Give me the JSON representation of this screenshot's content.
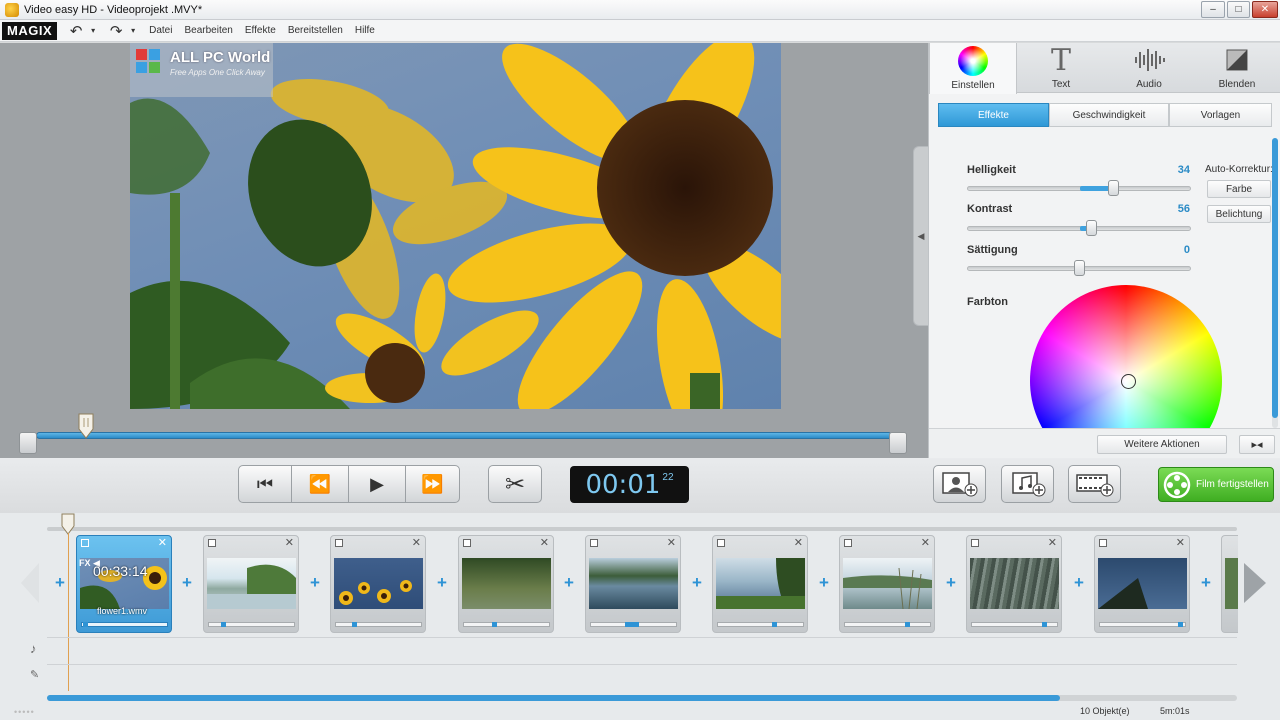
{
  "window": {
    "title": "Video easy HD - Videoprojekt .MVY*",
    "minimize": "–",
    "maximize": "□",
    "close": "✕"
  },
  "menu": {
    "logo": "MAGIX",
    "undo_icon": "↶",
    "redo_icon": "↷",
    "items": [
      "Datei",
      "Bearbeiten",
      "Effekte",
      "Bereitstellen",
      "Hilfe"
    ]
  },
  "watermark": {
    "title": "ALL PC World",
    "subtitle": "Free Apps One Click Away"
  },
  "panel": {
    "tabs": [
      "Einstellen",
      "Text",
      "Audio",
      "Blenden"
    ],
    "subtabs": [
      "Effekte",
      "Geschwindigkeit",
      "Vorlagen"
    ],
    "params": [
      {
        "label": "Helligkeit",
        "value": "34",
        "level": 0.65
      },
      {
        "label": "Kontrast",
        "value": "56",
        "level": 0.55
      },
      {
        "label": "Sättigung",
        "value": "0",
        "level": 0.5
      }
    ],
    "auto_label": "Auto-Korrektur:",
    "auto_buttons": [
      "Farbe",
      "Belichtung"
    ],
    "farbton_label": "Farbton",
    "more_actions": "Weitere Aktionen",
    "split_icon": "▸◂"
  },
  "transport": {
    "start_icon": "⏮",
    "rewind_icon": "⏪",
    "play_icon": "▶",
    "forward_icon": "⏩",
    "cut_icon": "✂"
  },
  "timecode": {
    "main": "00:01",
    "frames": "22"
  },
  "actions": {
    "finish": "Film fertigstellen"
  },
  "clips": [
    {
      "timecode": "00:33:14",
      "filename": "flower1.wmv",
      "fx": "FX ◀",
      "selected": true
    },
    {},
    {},
    {},
    {},
    {},
    {},
    {},
    {}
  ],
  "timeline": {
    "plus": "+",
    "music_icon": "♪",
    "mic_icon": "🎤",
    "dots": "•••••"
  },
  "status": {
    "objects": "10 Objekt(e)",
    "duration": "5m:01s"
  },
  "icons": {
    "scissors": "scissors-icon",
    "add_photo": "add-photo-icon",
    "add_music": "add-music-icon",
    "add_video": "add-video-icon"
  }
}
